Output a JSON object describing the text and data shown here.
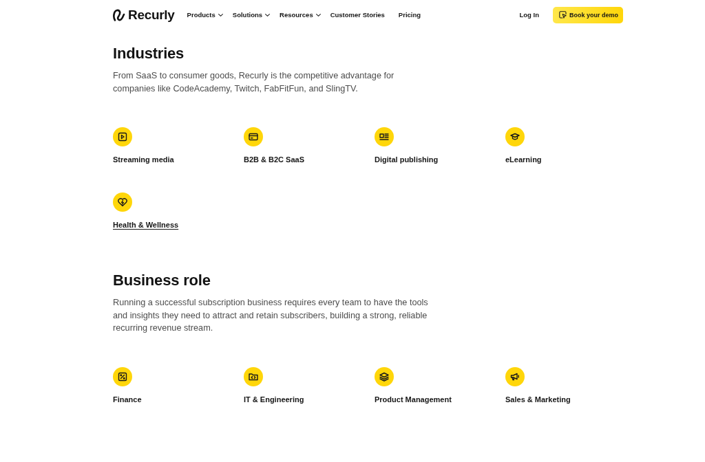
{
  "header": {
    "brand": "Recurly",
    "nav": [
      {
        "label": "Products",
        "has_menu": true
      },
      {
        "label": "Solutions",
        "has_menu": true
      },
      {
        "label": "Resources",
        "has_menu": true
      },
      {
        "label": "Customer Stories",
        "has_menu": false
      },
      {
        "label": "Pricing",
        "has_menu": false
      }
    ],
    "login": "Log In",
    "cta": "Book your demo"
  },
  "sections": [
    {
      "title": "Industries",
      "description": "From SaaS to consumer goods, Recurly is the competitive advantage for companies like CodeAcademy, Twitch, FabFitFun, and SlingTV.",
      "items": [
        {
          "label": "Streaming media",
          "underlined": false
        },
        {
          "label": "B2B & B2C SaaS",
          "underlined": false
        },
        {
          "label": "Digital publishing",
          "underlined": false
        },
        {
          "label": "eLearning",
          "underlined": false
        },
        {
          "label": "Health & Wellness",
          "underlined": true
        }
      ]
    },
    {
      "title": "Business role",
      "description": "Running a successful subscription business requires every team to have the tools and insights they need to attract and retain subscribers, building a strong, reliable recurring revenue stream.",
      "items": [
        {
          "label": "Finance",
          "underlined": false
        },
        {
          "label": "IT & Engineering",
          "underlined": false
        },
        {
          "label": "Product Management",
          "underlined": false
        },
        {
          "label": "Sales & Marketing",
          "underlined": false
        }
      ]
    }
  ]
}
